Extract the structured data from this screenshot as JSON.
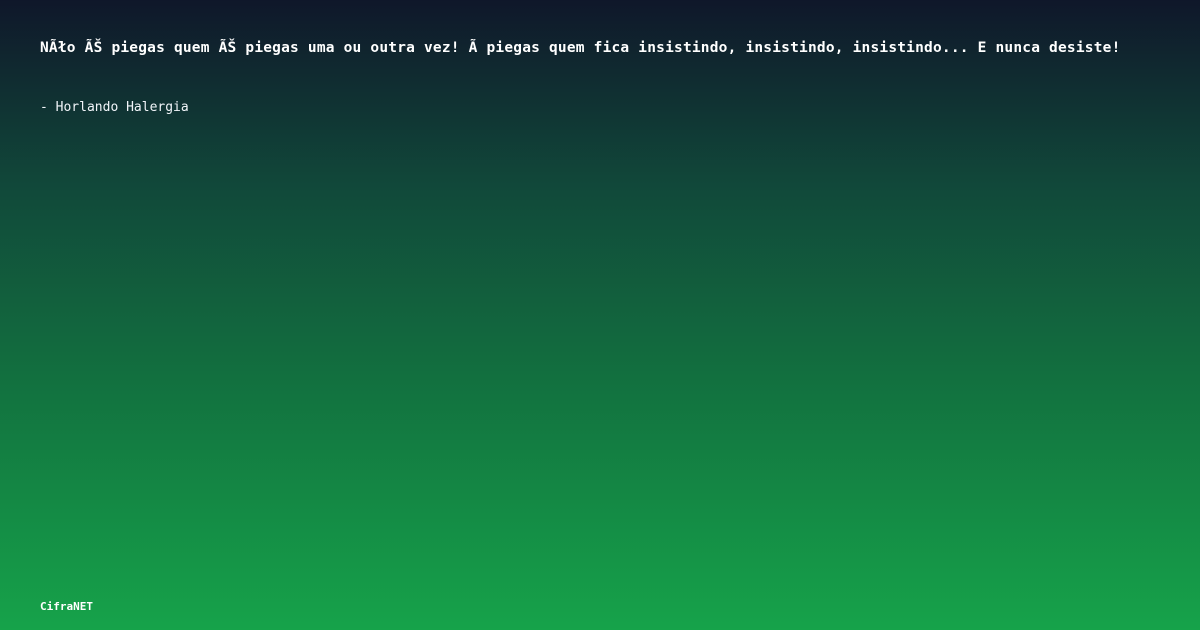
{
  "quote": {
    "text": "NÃło ÃŠ piegas quem ÃŠ piegas uma ou outra vez! Ã  piegas quem fica insistindo, insistindo, insistindo... E nunca desiste!",
    "author": "- Horlando Halergia"
  },
  "brand": {
    "name": "CifraNET"
  },
  "colors": {
    "gradient_top": "#0f172a",
    "gradient_bottom": "#16a34a",
    "text": "#ffffff"
  }
}
